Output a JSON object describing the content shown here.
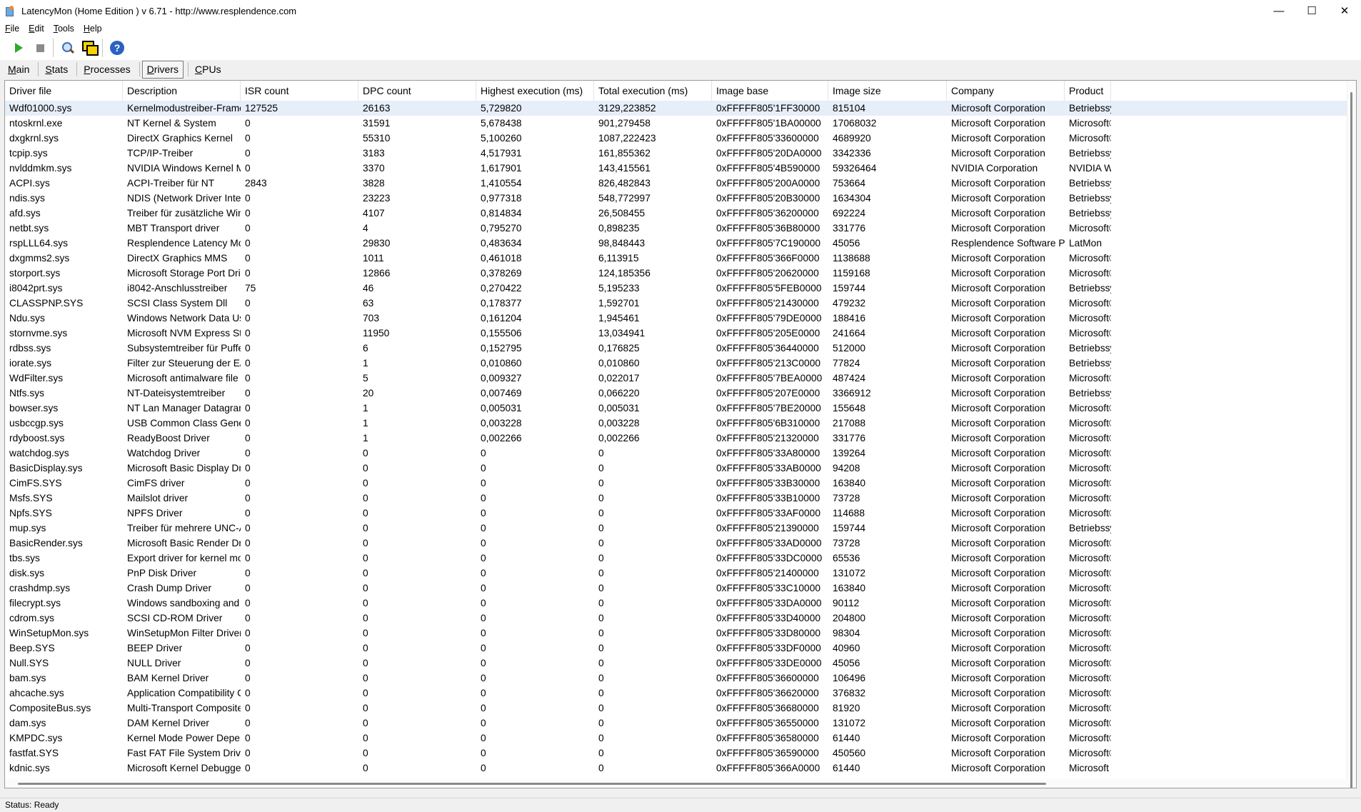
{
  "window": {
    "title": "LatencyMon  (Home Edition )  v 6.71 - http://www.resplendence.com",
    "minimize": "—",
    "maximize": "☐",
    "close": "✕"
  },
  "menu": [
    {
      "key": "F",
      "rest": "ile"
    },
    {
      "key": "E",
      "rest": "dit"
    },
    {
      "key": "T",
      "rest": "ools"
    },
    {
      "key": "H",
      "rest": "elp"
    }
  ],
  "toolbar": {
    "help_glyph": "?",
    "icons": [
      "play-icon",
      "stop-icon",
      "magnifier-icon",
      "windows-icon",
      "help-icon"
    ]
  },
  "tabs": [
    {
      "key": "M",
      "rest": "ain"
    },
    {
      "key": "S",
      "rest": "tats"
    },
    {
      "key": "P",
      "rest": "rocesses"
    },
    {
      "key": "D",
      "rest": "rivers"
    },
    {
      "key": "C",
      "rest": "PUs"
    }
  ],
  "active_tab": "Drivers",
  "columns": [
    "Driver file",
    "Description",
    "ISR count",
    "DPC count",
    "Highest execution (ms)",
    "Total execution (ms)",
    "Image base",
    "Image size",
    "Company",
    "Product"
  ],
  "rows": [
    [
      "Wdf01000.sys",
      "Kernelmodustreiber-Framew...",
      "127525",
      "26163",
      "5,729820",
      "3129,223852",
      "0xFFFFF805'1FF30000",
      "815104",
      "Microsoft Corporation",
      "Betriebssys"
    ],
    [
      "ntoskrnl.exe",
      "NT Kernel & System",
      "0",
      "31591",
      "5,678438",
      "901,279458",
      "0xFFFFF805'1BA00000",
      "17068032",
      "Microsoft Corporation",
      "Microsoft®"
    ],
    [
      "dxgkrnl.sys",
      "DirectX Graphics Kernel",
      "0",
      "55310",
      "5,100260",
      "1087,222423",
      "0xFFFFF805'33600000",
      "4689920",
      "Microsoft Corporation",
      "Microsoft®"
    ],
    [
      "tcpip.sys",
      "TCP/IP-Treiber",
      "0",
      "3183",
      "4,517931",
      "161,855362",
      "0xFFFFF805'20DA0000",
      "3342336",
      "Microsoft Corporation",
      "Betriebssys"
    ],
    [
      "nvlddmkm.sys",
      "NVIDIA Windows Kernel Mod...",
      "0",
      "3370",
      "1,617901",
      "143,415561",
      "0xFFFFF805'4B590000",
      "59326464",
      "NVIDIA Corporation",
      "NVIDIA Wir"
    ],
    [
      "ACPI.sys",
      "ACPI-Treiber für NT",
      "2843",
      "3828",
      "1,410554",
      "826,482843",
      "0xFFFFF805'200A0000",
      "753664",
      "Microsoft Corporation",
      "Betriebssys"
    ],
    [
      "ndis.sys",
      "NDIS (Network Driver Interf...",
      "0",
      "23223",
      "0,977318",
      "548,772997",
      "0xFFFFF805'20B30000",
      "1634304",
      "Microsoft Corporation",
      "Betriebssys"
    ],
    [
      "afd.sys",
      "Treiber für zusätzliche WinS...",
      "0",
      "4107",
      "0,814834",
      "26,508455",
      "0xFFFFF805'36200000",
      "692224",
      "Microsoft Corporation",
      "Betriebssys"
    ],
    [
      "netbt.sys",
      "MBT Transport driver",
      "0",
      "4",
      "0,795270",
      "0,898235",
      "0xFFFFF805'36B80000",
      "331776",
      "Microsoft Corporation",
      "Microsoft®"
    ],
    [
      "rspLLL64.sys",
      "Resplendence Latency Monit...",
      "0",
      "29830",
      "0,483634",
      "98,848443",
      "0xFFFFF805'7C190000",
      "45056",
      "Resplendence Software Proj...",
      "LatMon"
    ],
    [
      "dxgmms2.sys",
      "DirectX Graphics MMS",
      "0",
      "1011",
      "0,461018",
      "6,113915",
      "0xFFFFF805'366F0000",
      "1138688",
      "Microsoft Corporation",
      "Microsoft®"
    ],
    [
      "storport.sys",
      "Microsoft Storage Port Driver",
      "0",
      "12866",
      "0,378269",
      "124,185356",
      "0xFFFFF805'20620000",
      "1159168",
      "Microsoft Corporation",
      "Microsoft®"
    ],
    [
      "i8042prt.sys",
      "i8042-Anschlusstreiber",
      "75",
      "46",
      "0,270422",
      "5,195233",
      "0xFFFFF805'5FEB0000",
      "159744",
      "Microsoft Corporation",
      "Betriebssys"
    ],
    [
      "CLASSPNP.SYS",
      "SCSI Class System Dll",
      "0",
      "63",
      "0,178377",
      "1,592701",
      "0xFFFFF805'21430000",
      "479232",
      "Microsoft Corporation",
      "Microsoft®"
    ],
    [
      "Ndu.sys",
      "Windows Network Data Usa...",
      "0",
      "703",
      "0,161204",
      "1,945461",
      "0xFFFFF805'79DE0000",
      "188416",
      "Microsoft Corporation",
      "Microsoft®"
    ],
    [
      "stornvme.sys",
      "Microsoft NVM Express Stor...",
      "0",
      "11950",
      "0,155506",
      "13,034941",
      "0xFFFFF805'205E0000",
      "241664",
      "Microsoft Corporation",
      "Microsoft®"
    ],
    [
      "rdbss.sys",
      "Subsystemtreiber für Puffer...",
      "0",
      "6",
      "0,152795",
      "0,176825",
      "0xFFFFF805'36440000",
      "512000",
      "Microsoft Corporation",
      "Betriebssys"
    ],
    [
      "iorate.sys",
      "Filter zur Steuerung der E/A-...",
      "0",
      "1",
      "0,010860",
      "0,010860",
      "0xFFFFF805'213C0000",
      "77824",
      "Microsoft Corporation",
      "Betriebssys"
    ],
    [
      "WdFilter.sys",
      "Microsoft antimalware file sys...",
      "0",
      "5",
      "0,009327",
      "0,022017",
      "0xFFFFF805'7BEA0000",
      "487424",
      "Microsoft Corporation",
      "Microsoft®"
    ],
    [
      "Ntfs.sys",
      "NT-Dateisystemtreiber",
      "0",
      "20",
      "0,007469",
      "0,066220",
      "0xFFFFF805'207E0000",
      "3366912",
      "Microsoft Corporation",
      "Betriebssys"
    ],
    [
      "bowser.sys",
      "NT Lan Manager Datagram ...",
      "0",
      "1",
      "0,005031",
      "0,005031",
      "0xFFFFF805'7BE20000",
      "155648",
      "Microsoft Corporation",
      "Microsoft®"
    ],
    [
      "usbccgp.sys",
      "USB Common Class Generic ...",
      "0",
      "1",
      "0,003228",
      "0,003228",
      "0xFFFFF805'6B310000",
      "217088",
      "Microsoft Corporation",
      "Microsoft®"
    ],
    [
      "rdyboost.sys",
      "ReadyBoost Driver",
      "0",
      "1",
      "0,002266",
      "0,002266",
      "0xFFFFF805'21320000",
      "331776",
      "Microsoft Corporation",
      "Microsoft®"
    ],
    [
      "watchdog.sys",
      "Watchdog Driver",
      "0",
      "0",
      "0",
      "0",
      "0xFFFFF805'33A80000",
      "139264",
      "Microsoft Corporation",
      "Microsoft®"
    ],
    [
      "BasicDisplay.sys",
      "Microsoft Basic Display Driver",
      "0",
      "0",
      "0",
      "0",
      "0xFFFFF805'33AB0000",
      "94208",
      "Microsoft Corporation",
      "Microsoft®"
    ],
    [
      "CimFS.SYS",
      "CimFS driver",
      "0",
      "0",
      "0",
      "0",
      "0xFFFFF805'33B30000",
      "163840",
      "Microsoft Corporation",
      "Microsoft®"
    ],
    [
      "Msfs.SYS",
      "Mailslot driver",
      "0",
      "0",
      "0",
      "0",
      "0xFFFFF805'33B10000",
      "73728",
      "Microsoft Corporation",
      "Microsoft®"
    ],
    [
      "Npfs.SYS",
      "NPFS Driver",
      "0",
      "0",
      "0",
      "0",
      "0xFFFFF805'33AF0000",
      "114688",
      "Microsoft Corporation",
      "Microsoft®"
    ],
    [
      "mup.sys",
      "Treiber für mehrere UNC-An...",
      "0",
      "0",
      "0",
      "0",
      "0xFFFFF805'21390000",
      "159744",
      "Microsoft Corporation",
      "Betriebssys"
    ],
    [
      "BasicRender.sys",
      "Microsoft Basic Render Driver",
      "0",
      "0",
      "0",
      "0",
      "0xFFFFF805'33AD0000",
      "73728",
      "Microsoft Corporation",
      "Microsoft®"
    ],
    [
      "tbs.sys",
      "Export driver for kernel mod...",
      "0",
      "0",
      "0",
      "0",
      "0xFFFFF805'33DC0000",
      "65536",
      "Microsoft Corporation",
      "Microsoft®"
    ],
    [
      "disk.sys",
      "PnP Disk Driver",
      "0",
      "0",
      "0",
      "0",
      "0xFFFFF805'21400000",
      "131072",
      "Microsoft Corporation",
      "Microsoft®"
    ],
    [
      "crashdmp.sys",
      "Crash Dump Driver",
      "0",
      "0",
      "0",
      "0",
      "0xFFFFF805'33C10000",
      "163840",
      "Microsoft Corporation",
      "Microsoft®"
    ],
    [
      "filecrypt.sys",
      "Windows sandboxing and e...",
      "0",
      "0",
      "0",
      "0",
      "0xFFFFF805'33DA0000",
      "90112",
      "Microsoft Corporation",
      "Microsoft®"
    ],
    [
      "cdrom.sys",
      "SCSI CD-ROM Driver",
      "0",
      "0",
      "0",
      "0",
      "0xFFFFF805'33D40000",
      "204800",
      "Microsoft Corporation",
      "Microsoft®"
    ],
    [
      "WinSetupMon.sys",
      "WinSetupMon Filter Driver",
      "0",
      "0",
      "0",
      "0",
      "0xFFFFF805'33D80000",
      "98304",
      "Microsoft Corporation",
      "Microsoft®"
    ],
    [
      "Beep.SYS",
      "BEEP Driver",
      "0",
      "0",
      "0",
      "0",
      "0xFFFFF805'33DF0000",
      "40960",
      "Microsoft Corporation",
      "Microsoft®"
    ],
    [
      "Null.SYS",
      "NULL Driver",
      "0",
      "0",
      "0",
      "0",
      "0xFFFFF805'33DE0000",
      "45056",
      "Microsoft Corporation",
      "Microsoft®"
    ],
    [
      "bam.sys",
      "BAM Kernel Driver",
      "0",
      "0",
      "0",
      "0",
      "0xFFFFF805'36600000",
      "106496",
      "Microsoft Corporation",
      "Microsoft®"
    ],
    [
      "ahcache.sys",
      "Application Compatibility Cac...",
      "0",
      "0",
      "0",
      "0",
      "0xFFFFF805'36620000",
      "376832",
      "Microsoft Corporation",
      "Microsoft®"
    ],
    [
      "CompositeBus.sys",
      "Multi-Transport Composite B...",
      "0",
      "0",
      "0",
      "0",
      "0xFFFFF805'36680000",
      "81920",
      "Microsoft Corporation",
      "Microsoft®"
    ],
    [
      "dam.sys",
      "DAM Kernel Driver",
      "0",
      "0",
      "0",
      "0",
      "0xFFFFF805'36550000",
      "131072",
      "Microsoft Corporation",
      "Microsoft®"
    ],
    [
      "KMPDC.sys",
      "Kernel Mode Power Depend...",
      "0",
      "0",
      "0",
      "0",
      "0xFFFFF805'36580000",
      "61440",
      "Microsoft Corporation",
      "Microsoft®"
    ],
    [
      "fastfat.SYS",
      "Fast FAT File System Driver",
      "0",
      "0",
      "0",
      "0",
      "0xFFFFF805'36590000",
      "450560",
      "Microsoft Corporation",
      "Microsoft®"
    ],
    [
      "kdnic.sys",
      "Microsoft Kernel Debugger N...",
      "0",
      "0",
      "0",
      "0",
      "0xFFFFF805'366A0000",
      "61440",
      "Microsoft Corporation",
      "Microsoft Ke"
    ]
  ],
  "status": "Status: Ready",
  "colors": {
    "selection": "#e6eef9",
    "play": "#2eaa2e",
    "help": "#2a61c2"
  }
}
